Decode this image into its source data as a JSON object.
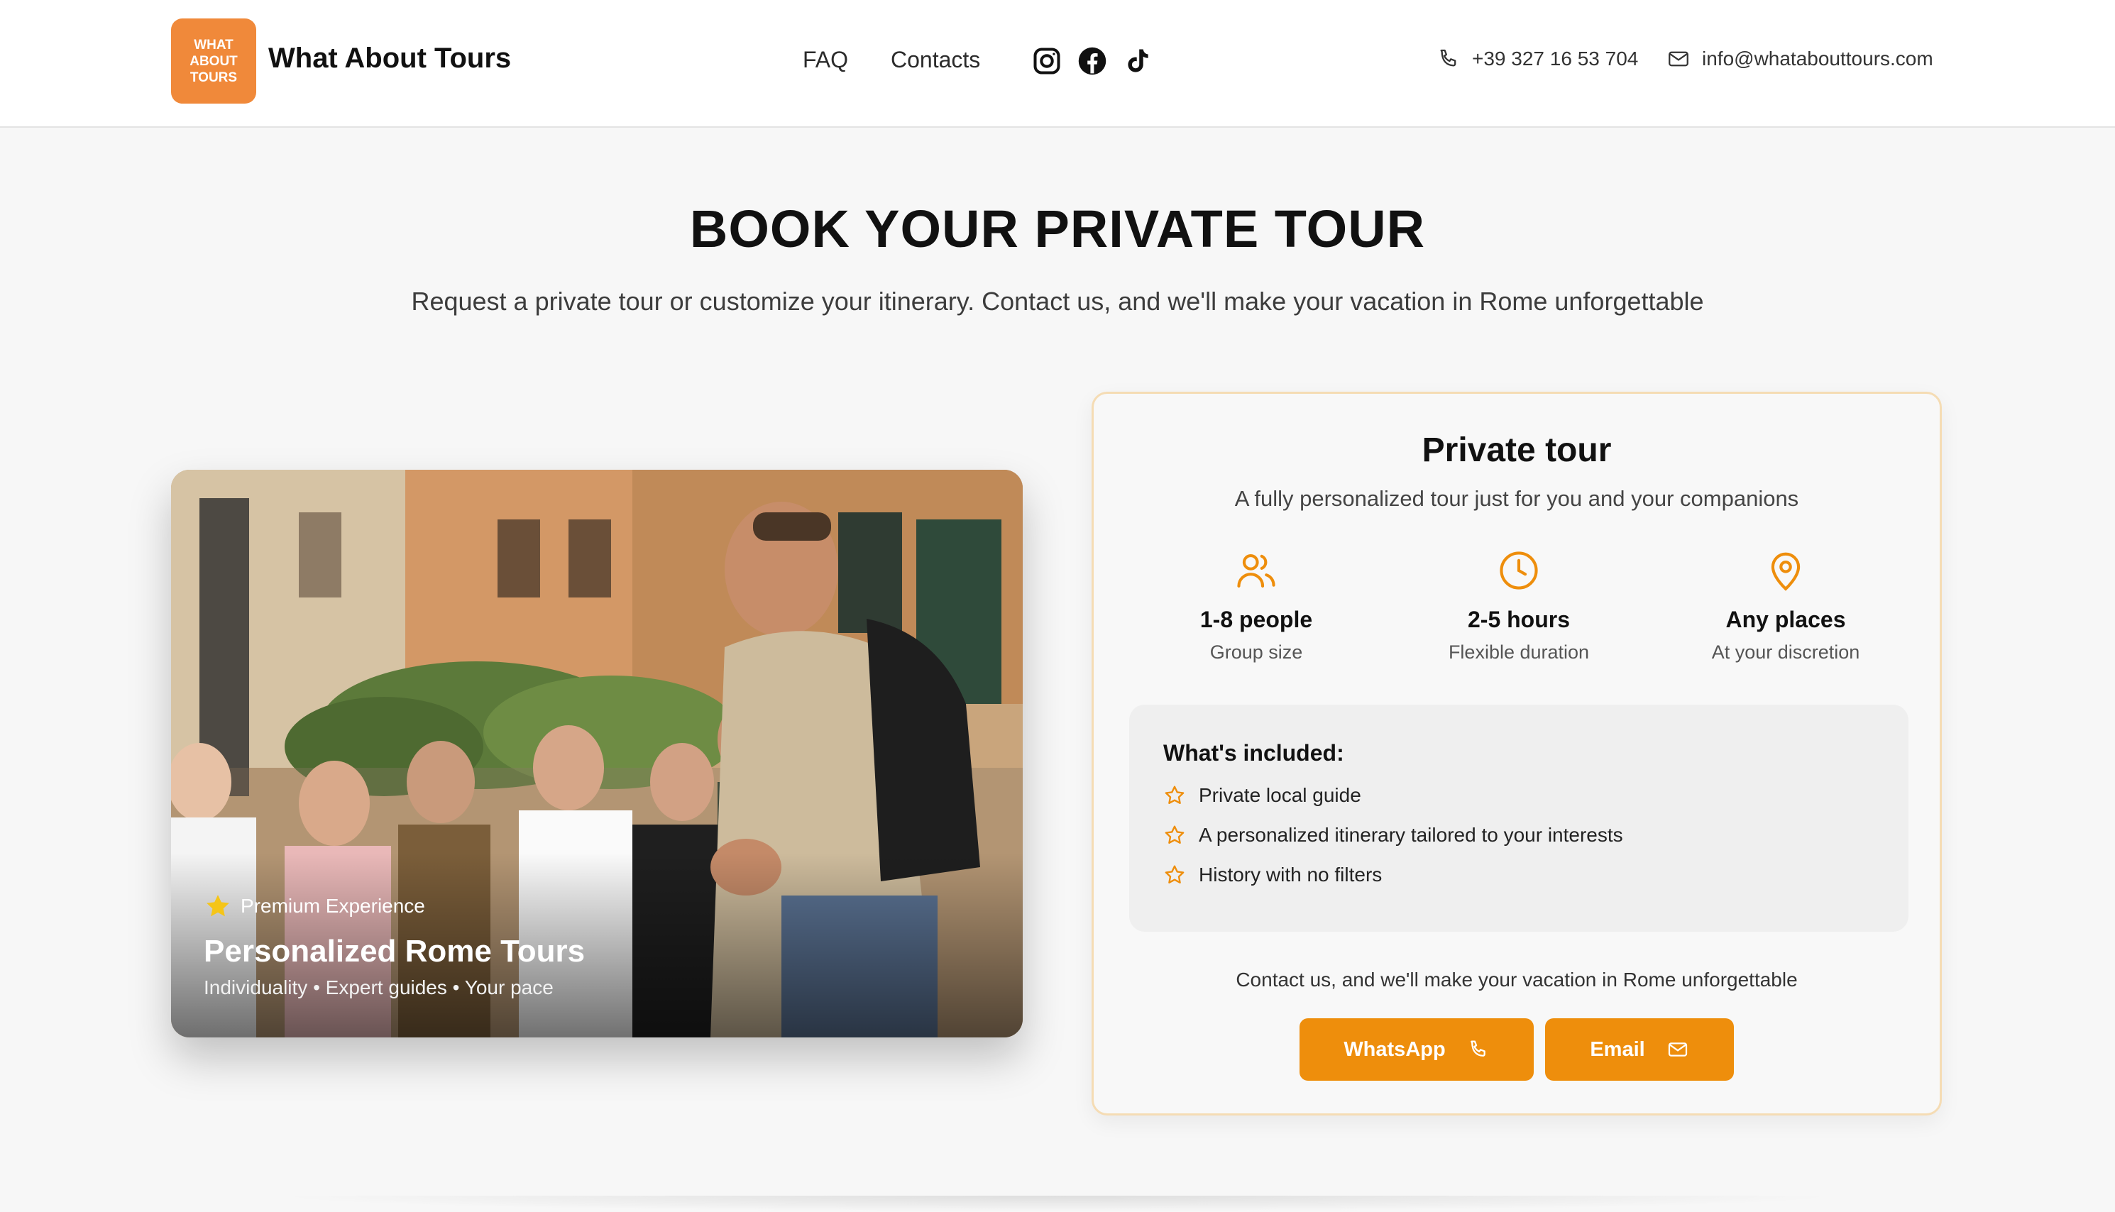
{
  "header": {
    "logo_lines": [
      "WHAT",
      "ABOUT",
      "TOURS"
    ],
    "brand_name": "What About Tours",
    "nav": {
      "faq": "FAQ",
      "contacts": "Contacts"
    },
    "social_icons": [
      "instagram-icon",
      "facebook-icon",
      "tiktok-icon"
    ],
    "phone": "+39 327 16 53 704",
    "email": "info@whatabouttours.com"
  },
  "hero": {
    "title": "BOOK YOUR PRIVATE TOUR",
    "subtitle": "Request a private tour or customize your itinerary. Contact us, and we'll make your vacation in Rome unforgettable"
  },
  "photo_card": {
    "badge": "Premium Experience",
    "title": "Personalized Rome Tours",
    "tags": "Individuality • Expert guides • Your pace"
  },
  "tour_card": {
    "title": "Private tour",
    "description": "A fully personalized tour just for you and your companions",
    "features": [
      {
        "icon": "users-icon",
        "title": "1-8 people",
        "subtitle": "Group size"
      },
      {
        "icon": "clock-icon",
        "title": "2-5 hours",
        "subtitle": "Flexible duration"
      },
      {
        "icon": "map-pin-icon",
        "title": "Any places",
        "subtitle": "At your discretion"
      }
    ],
    "included": {
      "title": "What's included:",
      "items": [
        "Private local guide",
        "A personalized itinerary tailored to your interests",
        "History with no filters"
      ]
    },
    "contact_note": "Contact us, and we'll make your vacation in Rome unforgettable",
    "buttons": {
      "whatsapp": "WhatsApp",
      "email": "Email"
    }
  },
  "colors": {
    "accent": "#ee8e0c",
    "logo_bg": "#f0893a",
    "card_border": "#f5dcb4",
    "page_bg": "#f7f7f7"
  }
}
